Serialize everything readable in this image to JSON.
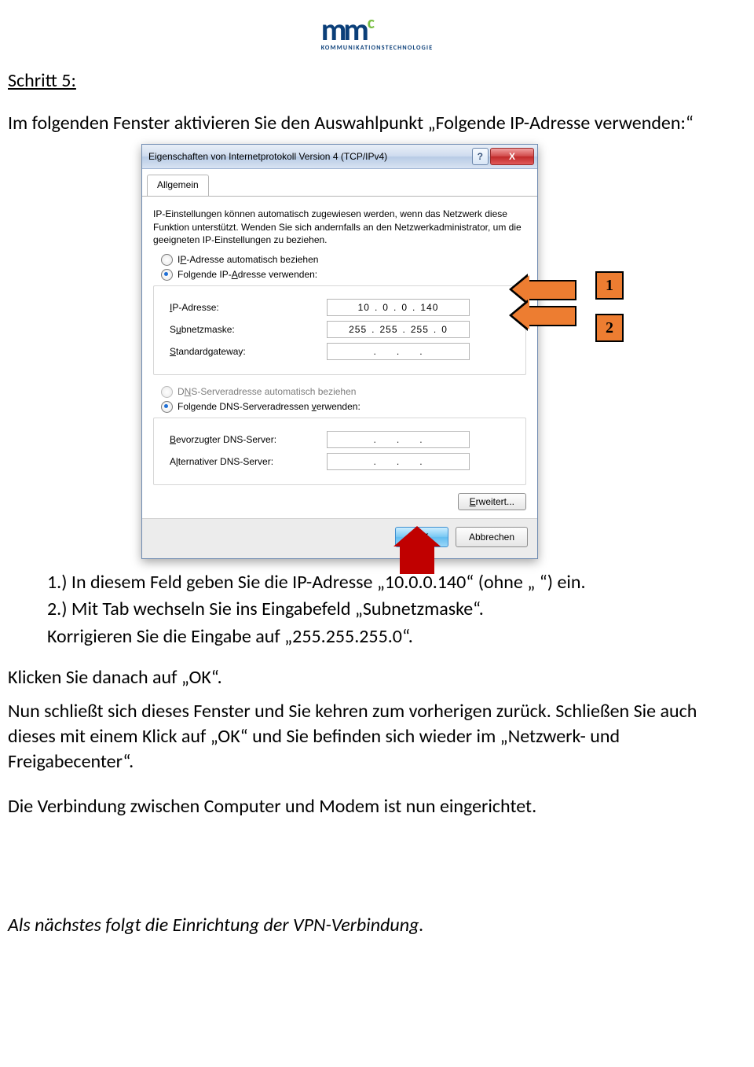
{
  "logo": {
    "main": "mm",
    "sup": "c",
    "sub": "KOMMUNIKATIONSTECHNOLOGIE"
  },
  "step_heading": "Schritt 5:",
  "intro": "Im folgenden Fenster aktivieren Sie den Auswahlpunkt „Folgende IP-Adresse verwenden:“",
  "list": {
    "item1": "1.) In diesem Feld geben Sie die IP-Adresse „10.0.0.140“ (ohne „ “) ein.",
    "item2a": "2.) Mit Tab wechseln Sie ins Eingabefeld „Subnetzmaske“.",
    "item2b": "Korrigieren Sie die Eingabe auf „255.255.255.0“."
  },
  "after_list1": "Klicken Sie danach auf „OK“.",
  "after_list2": "Nun schließt sich dieses Fenster und Sie kehren zum vorherigen zurück. Schließen Sie auch dieses mit einem Klick auf „OK“ und Sie befinden sich wieder im „Netzwerk- und Freigabecenter“.",
  "after_list3": "Die Verbindung zwischen Computer und Modem ist nun eingerichtet.",
  "footer_italic": "Als nächstes folgt die Einrichtung der VPN-Verbindung.",
  "dialog": {
    "title": "Eigenschaften von Internetprotokoll Version 4 (TCP/IPv4)",
    "help_icon": "?",
    "close_icon": "X",
    "tab": "Allgemein",
    "description": "IP-Einstellungen können automatisch zugewiesen werden, wenn das Netzwerk diese Funktion unterstützt. Wenden Sie sich andernfalls an den Netzwerkadministrator, um die geeigneten IP-Einstellungen zu beziehen.",
    "radio_ip_auto_pre": "I",
    "radio_ip_auto_uchar": "P",
    "radio_ip_auto_post": "-Adresse automatisch beziehen",
    "radio_ip_manual_pre": "Folgende IP-",
    "radio_ip_manual_uchar": "A",
    "radio_ip_manual_post": "dresse verwenden:",
    "ip_label": "IP-Adresse:",
    "ip_uchar": "I",
    "ip_value": {
      "a": "10",
      "b": "0",
      "c": "0",
      "d": "140"
    },
    "subnet_label_pre": "S",
    "subnet_label_uchar": "u",
    "subnet_label_post": "bnetzmaske:",
    "subnet_value": {
      "a": "255",
      "b": "255",
      "c": "255",
      "d": "0"
    },
    "gateway_label_pre": "",
    "gateway_label_uchar": "S",
    "gateway_label_post": "tandardgateway:",
    "radio_dns_auto_pre": "D",
    "radio_dns_auto_uchar": "N",
    "radio_dns_auto_post": "S-Serveradresse automatisch beziehen",
    "radio_dns_manual_pre": "Folgende DNS-Serveradressen ",
    "radio_dns_manual_uchar": "v",
    "radio_dns_manual_post": "erwenden:",
    "dns1_label_pre": "",
    "dns1_label_uchar": "B",
    "dns1_label_post": "evorzugter DNS-Server:",
    "dns2_label_pre": "A",
    "dns2_label_uchar": "l",
    "dns2_label_post": "ternativer DNS-Server:",
    "advanced_btn_pre": "",
    "advanced_btn_uchar": "E",
    "advanced_btn_post": "rweitert...",
    "ok_btn": "OK",
    "cancel_btn": "Abbrechen"
  },
  "markers": {
    "one": "1",
    "two": "2"
  }
}
